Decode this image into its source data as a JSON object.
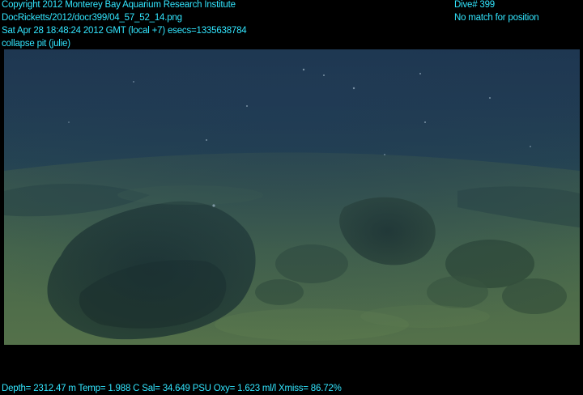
{
  "overlay": {
    "copyright": "Copyright 2012 Monterey Bay Aquarium Research Institute",
    "filename": "DocRicketts/2012/docr399/04_57_52_14.png",
    "datetime": "Sat Apr 28 18:48:24 2012 GMT (local +7)  esecs=1335638784",
    "annotation": "collapse pit (julie)",
    "dive": "Dive# 399",
    "position_status": "No match for position",
    "telemetry": "Depth= 2312.47 m  Temp= 1.988 C  Sal= 34.649 PSU  Oxy= 1.623 ml/l  Xmiss= 86.72%"
  },
  "colors": {
    "overlay_text": "#32e6ff",
    "background": "#000000"
  }
}
